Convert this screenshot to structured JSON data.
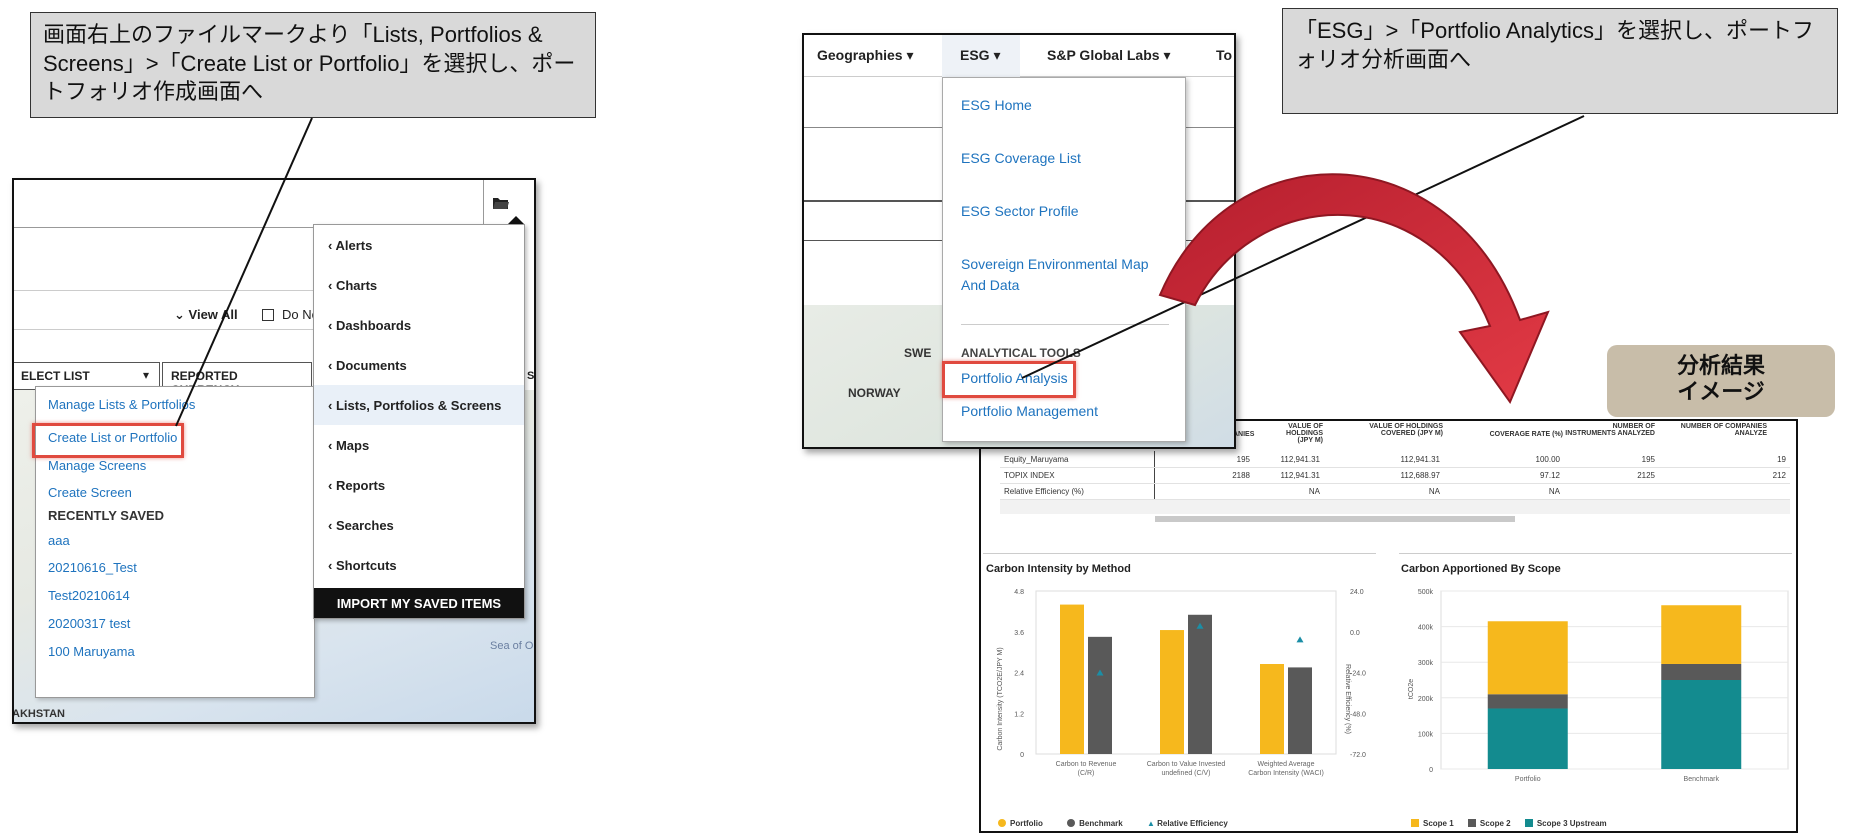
{
  "callouts": {
    "left": "画面右上のファイルマークより「Lists, Portfolios & Screens」>「Create List or Portfolio」を選択し、ポートフォリオ作成画面へ",
    "right": "「ESG」>「Portfolio Analytics」を選択し、ポートフォリオ分析画面へ"
  },
  "badge": {
    "line1": "分析結果",
    "line2": "イメージ"
  },
  "panel1": {
    "view_all": "View All",
    "do_not": "Do Not",
    "select_list": "ELECT LIST",
    "reported_currency": "REPORTED CURRENCY",
    "sa": "SA",
    "left_menu": [
      "Manage Lists & Portfolios",
      "Create List or Portfolio",
      "Manage Screens",
      "Create Screen"
    ],
    "recently_saved_label": "RECENTLY SAVED",
    "recent_items": [
      "aaa",
      "20210616_Test",
      "Test20210614",
      "20200317 test",
      "100 Maruyama"
    ],
    "right_menu": [
      "Alerts",
      "Charts",
      "Dashboards",
      "Documents",
      "Lists, Portfolios & Screens",
      "Maps",
      "Reports",
      "Searches",
      "Shortcuts"
    ],
    "import_label": "IMPORT MY SAVED ITEMS",
    "map_labels": {
      "sea": "Sea of O",
      "kazakhstan": "AKHSTAN"
    }
  },
  "panel2": {
    "nav": [
      "Geographies",
      "ESG",
      "S&P Global Labs",
      "To"
    ],
    "esg_menu": [
      "ESG Home",
      "ESG Coverage List",
      "ESG Sector Profile",
      "Sovereign Environmental Map And Data"
    ],
    "analytical_label": "ANALYTICAL TOOLS",
    "analytical_items": [
      "Portfolio Analysis",
      "Portfolio Management"
    ],
    "map_labels": {
      "sweden": "SWE",
      "norway": "NORWAY"
    }
  },
  "panel3": {
    "headers": [
      "ANIES",
      "VALUE OF HOLDINGS (JPY M)",
      "VALUE OF HOLDINGS COVERED (JPY M)",
      "COVERAGE RATE (%)",
      "NUMBER OF INSTRUMENTS ANALYZED",
      "NUMBER OF COMPANIES ANALYZE"
    ],
    "rows": [
      {
        "name": "Equity_Maruyama",
        "cells": [
          "195",
          "112,941.31",
          "112,941.31",
          "100.00",
          "195",
          "19"
        ]
      },
      {
        "name": "TOPIX INDEX",
        "cells": [
          "2188",
          "112,941.31",
          "112,688.97",
          "97.12",
          "2125",
          "212"
        ]
      },
      {
        "name": "Relative Efficiency (%)",
        "cells": [
          "",
          "NA",
          "NA",
          "NA",
          "",
          ""
        ]
      }
    ],
    "chart_titles": {
      "left": "Carbon Intensity by Method",
      "right": "Carbon Apportioned By Scope"
    }
  },
  "chart_data": [
    {
      "type": "bar",
      "title": "Carbon Intensity by Method",
      "categories": [
        "Carbon to Revenue (C/R)",
        "Carbon to Value Invested (C/V)",
        "Weighted Average Carbon Intensity (WACI)"
      ],
      "series": [
        {
          "name": "Portfolio",
          "values": [
            4.4,
            3.65,
            2.65
          ],
          "color": "#f6b81d"
        },
        {
          "name": "Benchmark",
          "values": [
            3.45,
            4.1,
            2.55
          ],
          "color": "#595959"
        },
        {
          "name": "Relative Efficiency",
          "axis": "right",
          "marker": "triangle",
          "values": [
            -24.0,
            3.5,
            -4.5
          ],
          "color": "#1b8ea6"
        }
      ],
      "ylabel": "Carbon Intensity (TCO2E/JPY M)",
      "ylabel_right": "Relative Efficiency (%)",
      "ylim": [
        0,
        4.8
      ],
      "yticks": [
        "0",
        "1.2",
        "2.4",
        "3.6",
        "4.8"
      ],
      "ylim_right": [
        -72,
        24
      ],
      "yticks_right": [
        "-72.0",
        "-48.0",
        "-24.0",
        "0.0",
        "24.0"
      ],
      "legend": "bottom-left"
    },
    {
      "type": "bar",
      "stacked": true,
      "title": "Carbon Apportioned By Scope",
      "categories": [
        "Portfolio",
        "Benchmark"
      ],
      "series": [
        {
          "name": "Scope 1",
          "values": [
            205000,
            165000
          ],
          "color": "#f6b81d"
        },
        {
          "name": "Scope 2",
          "values": [
            40000,
            45000
          ],
          "color": "#595959"
        },
        {
          "name": "Scope 3 Upstream",
          "values": [
            170000,
            250000
          ],
          "color": "#138b8f"
        }
      ],
      "ylabel": "tCO2e",
      "ylim": [
        0,
        500000
      ],
      "yticks": [
        "0",
        "100k",
        "200k",
        "300k",
        "400k",
        "500k"
      ],
      "legend": "bottom-left"
    }
  ]
}
